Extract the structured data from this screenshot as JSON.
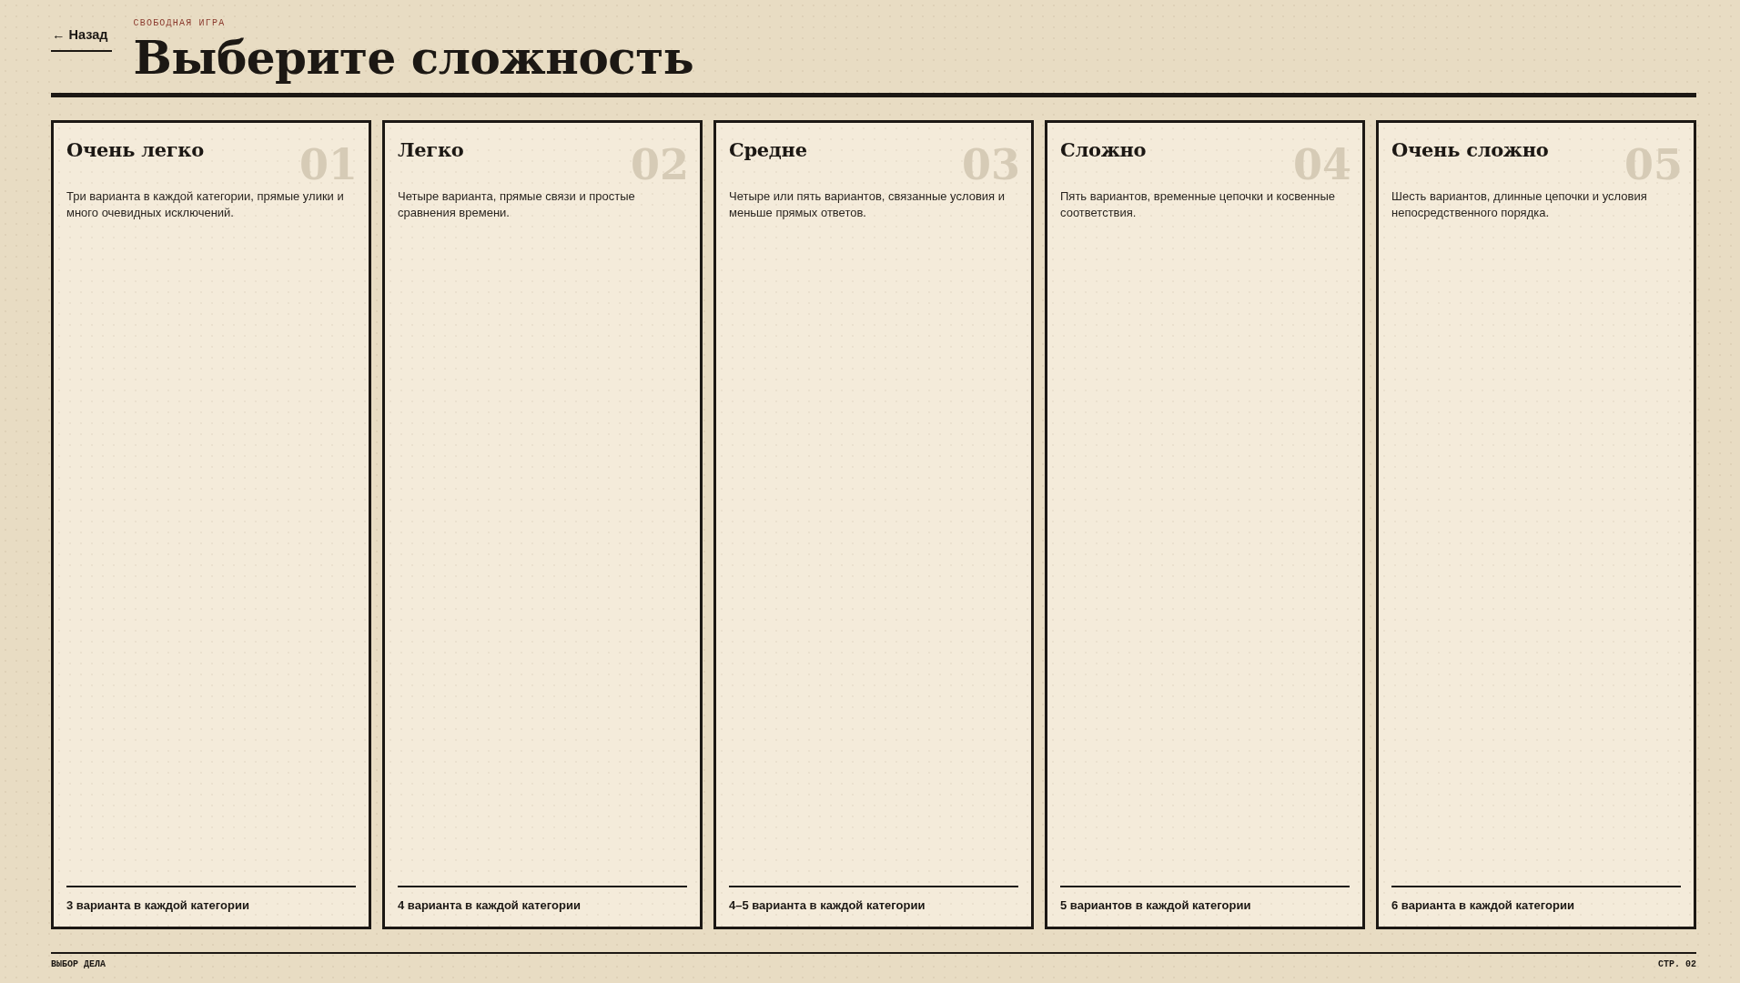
{
  "back_link": {
    "label": "← Назад"
  },
  "header": {
    "kicker": "СВОБОДНАЯ ИГРА",
    "title": "Выберите сложность"
  },
  "difficulties": [
    {
      "title": "Очень легко",
      "number": "01",
      "description": "Три варианта в каждой категории, прямые улики и много очевидных исключений.",
      "options_note": "3 варианта в каждой категории"
    },
    {
      "title": "Легко",
      "number": "02",
      "description": "Четыре варианта, прямые связи и простые сравнения времени.",
      "options_note": "4 варианта в каждой категории"
    },
    {
      "title": "Средне",
      "number": "03",
      "description": "Четыре или пять вариантов, связанные условия и меньше прямых ответов.",
      "options_note": "4–5 варианта в каждой категории"
    },
    {
      "title": "Сложно",
      "number": "04",
      "description": "Пять вариантов, временные цепочки и косвенные соответствия.",
      "options_note": "5 вариантов в каждой категории"
    },
    {
      "title": "Очень сложно",
      "number": "05",
      "description": "Шесть вариантов, длинные цепочки и условия непосредственного порядка.",
      "options_note": "6 варианта в каждой категории"
    }
  ],
  "footer": {
    "section": "ВЫБОР ДЕЛА",
    "page": "СТР. 02"
  }
}
